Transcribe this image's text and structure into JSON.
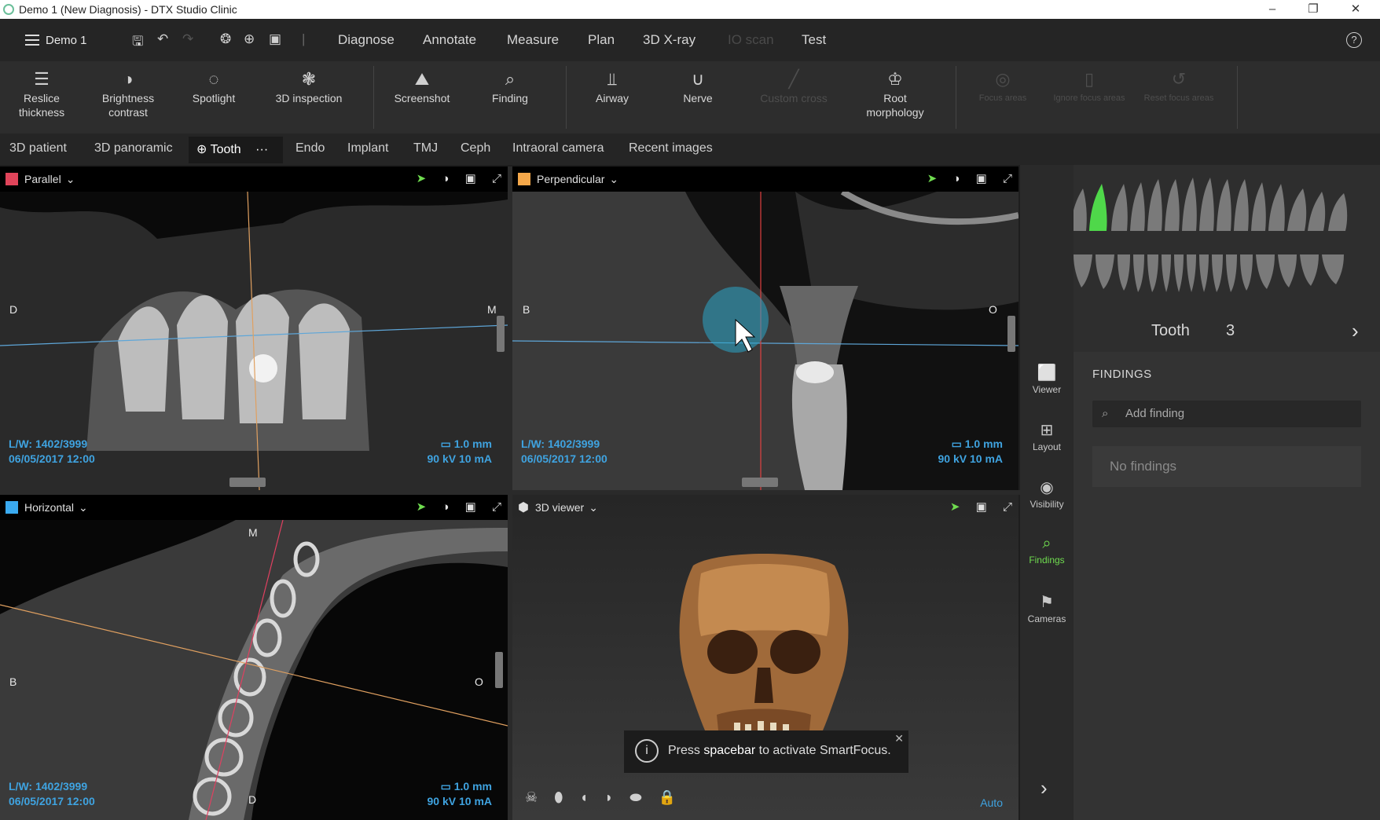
{
  "window": {
    "title": "Demo 1 (New Diagnosis) - DTX Studio Clinic",
    "minimize": "–",
    "restore": "❐",
    "close": "✕"
  },
  "menubar": {
    "patient_label": "Demo 1",
    "tabs": [
      {
        "label": "Diagnose",
        "state": "active"
      },
      {
        "label": "Annotate",
        "state": "normal"
      },
      {
        "label": "Measure",
        "state": "normal"
      },
      {
        "label": "Plan",
        "state": "normal"
      },
      {
        "label": "3D X-ray",
        "state": "normal"
      },
      {
        "label": "IO scan",
        "state": "disabled"
      },
      {
        "label": "Test",
        "state": "normal"
      }
    ],
    "help": "?"
  },
  "toolbar": {
    "tools": [
      {
        "label": "Reslice thickness",
        "icon": "layers-icon"
      },
      {
        "label": "Brightness contrast",
        "icon": "contrast-icon"
      },
      {
        "label": "Spotlight",
        "icon": "spotlight-icon"
      },
      {
        "label": "3D inspection",
        "icon": "3d-inspection-icon"
      },
      {
        "label": "Screenshot",
        "icon": "screenshot-icon"
      },
      {
        "label": "Finding",
        "icon": "finding-icon"
      },
      {
        "label": "Airway",
        "icon": "airway-icon"
      },
      {
        "label": "Nerve",
        "icon": "nerve-icon"
      },
      {
        "label": "Custom cross",
        "icon": "custom-cross-icon",
        "disabled": true
      },
      {
        "label": "Root morphology",
        "icon": "root-morphology-icon"
      },
      {
        "label": "Focus areas",
        "icon": "focus-areas-icon",
        "disabled": true
      },
      {
        "label": "Ignore focus areas",
        "icon": "ignore-focus-icon",
        "disabled": true
      },
      {
        "label": "Reset focus areas",
        "icon": "reset-focus-icon",
        "disabled": true
      }
    ]
  },
  "subtabs": {
    "items": [
      "3D patient",
      "3D panoramic",
      "Tooth",
      "Endo",
      "Implant",
      "TMJ",
      "Ceph",
      "Intraoral camera",
      "Recent images"
    ],
    "active": "Tooth",
    "more": "···"
  },
  "viewports": {
    "parallel": {
      "label": "Parallel",
      "color": "#e0445a",
      "left_marker": "D",
      "right_marker": "M",
      "lw": "L/W: 1402/3999",
      "datetime": "06/05/2017 12:00",
      "thickness": "1.0 mm",
      "exposure": "90 kV  10 mA"
    },
    "perpendicular": {
      "label": "Perpendicular",
      "color": "#f5a84a",
      "left_marker": "B",
      "right_marker": "O",
      "lw": "L/W: 1402/3999",
      "datetime": "06/05/2017 12:00",
      "thickness": "1.0 mm",
      "exposure": "90 kV  10 mA"
    },
    "horizontal": {
      "label": "Horizontal",
      "color": "#3aaaf0",
      "top_marker": "M",
      "bottom_marker": "D",
      "left_marker": "B",
      "right_marker": "O",
      "lw": "L/W: 1402/3999",
      "datetime": "06/05/2017 12:00",
      "thickness": "1.0 mm",
      "exposure": "90 kV  10 mA"
    },
    "viewer3d": {
      "label": "3D viewer",
      "auto_label": "Auto"
    }
  },
  "toast": {
    "prefix": "Press ",
    "key": "spacebar",
    "suffix": " to activate SmartFocus.",
    "close": "✕"
  },
  "sidebar": {
    "items": [
      {
        "label": "Viewer",
        "icon": "viewer-icon"
      },
      {
        "label": "Layout",
        "icon": "layout-icon"
      },
      {
        "label": "Visibility",
        "icon": "eye-icon"
      },
      {
        "label": "Findings",
        "icon": "findings-icon",
        "active": true
      },
      {
        "label": "Cameras",
        "icon": "camera-icon"
      }
    ],
    "expand": "›"
  },
  "tooth_selector": {
    "label": "Tooth",
    "number": "3",
    "prev": "‹",
    "next": "›",
    "highlight_color": "#4fd84a"
  },
  "findings": {
    "title": "FINDINGS",
    "add_placeholder": "Add finding",
    "empty_text": "No findings"
  }
}
